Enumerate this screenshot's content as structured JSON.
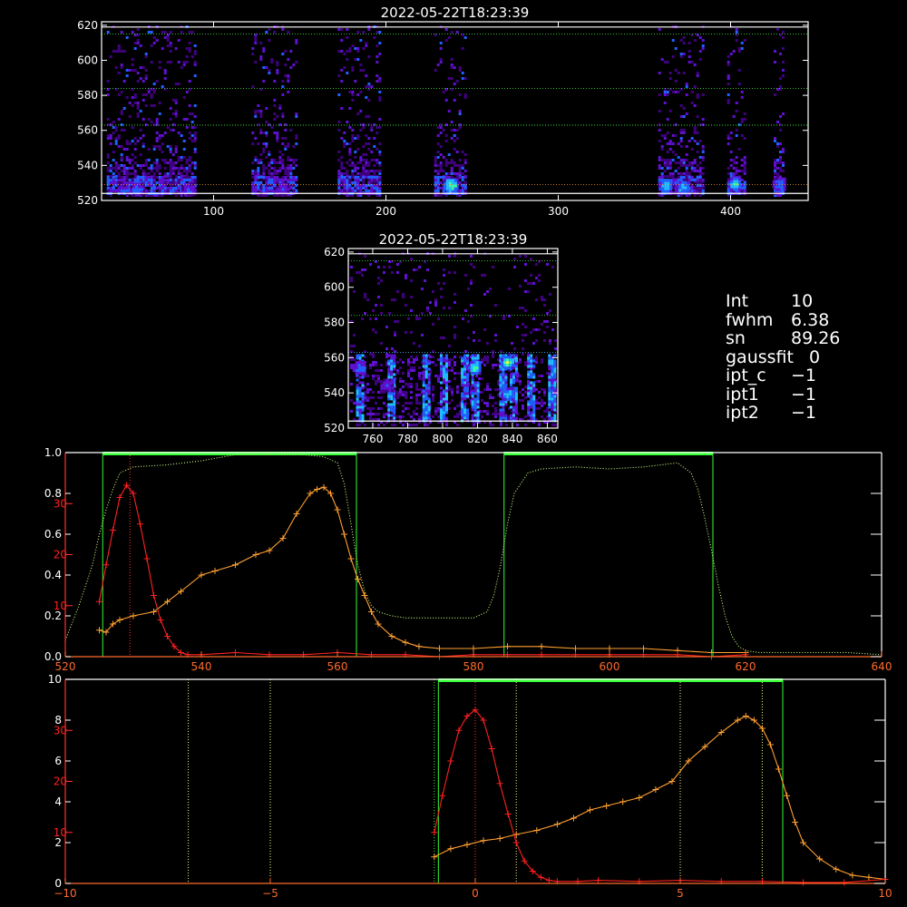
{
  "colors": {
    "background": "#000000",
    "frame": "#ffffff",
    "gaussian_series": "#ff2020",
    "profile_series": "#ffa030",
    "window_line": "#33ff33",
    "transmission_curve": "#c8ff80",
    "guide_line": "#ffff80",
    "right_axis": "#ff2020",
    "bottom_axis": "#ff6a2a"
  },
  "params": [
    {
      "label": "Int",
      "value": "10"
    },
    {
      "label": "fwhm",
      "value": "6.38"
    },
    {
      "label": "sn",
      "value": "89.26"
    },
    {
      "label": "gaussfit",
      "value": "0"
    },
    {
      "label": "ipt_c",
      "value": "−1"
    },
    {
      "label": "ipt1",
      "value": "−1"
    },
    {
      "label": "ipt2",
      "value": "−1"
    }
  ],
  "chart_data": [
    {
      "type": "heatmap",
      "title": "2022-05-22T18:23:39",
      "xlim": [
        35,
        445
      ],
      "ylim": [
        520,
        622
      ],
      "xticks": [
        "100",
        "200",
        "300",
        "400"
      ],
      "yticks": [
        "520",
        "540",
        "560",
        "580",
        "600",
        "620"
      ],
      "columns": [
        [
          38,
          90
        ],
        [
          122,
          148
        ],
        [
          172,
          196
        ],
        [
          228,
          246
        ],
        [
          358,
          384
        ],
        [
          398,
          408
        ],
        [
          425,
          430
        ]
      ],
      "hotspots": [
        {
          "x": 237,
          "y": 529,
          "level": 0.95
        },
        {
          "x": 362,
          "y": 529,
          "level": 0.8
        },
        {
          "x": 372,
          "y": 528,
          "level": 0.75
        },
        {
          "x": 402,
          "y": 530,
          "level": 0.8
        },
        {
          "x": 428,
          "y": 530,
          "level": 0.6
        },
        {
          "x": 55,
          "y": 527,
          "level": 0.55
        },
        {
          "x": 85,
          "y": 527,
          "level": 0.5
        },
        {
          "x": 140,
          "y": 527,
          "level": 0.45
        }
      ],
      "hlines_white": [
        524,
        619
      ],
      "hlines_green": [
        563,
        584,
        615
      ],
      "hlines_orange": [
        529
      ]
    },
    {
      "type": "heatmap",
      "title": "2022-05-22T18:23:39",
      "xlim": [
        746,
        866
      ],
      "ylim": [
        520,
        622
      ],
      "xticks": [
        "760",
        "780",
        "800",
        "820",
        "840",
        "860"
      ],
      "yticks": [
        "520",
        "540",
        "560",
        "580",
        "600",
        "620"
      ],
      "streaks": [
        752,
        770,
        790,
        800,
        812,
        818,
        834,
        840,
        850,
        862
      ],
      "hotspots": [
        {
          "x": 818,
          "y": 555,
          "level": 0.85
        },
        {
          "x": 837,
          "y": 558,
          "level": 0.9
        },
        {
          "x": 837,
          "y": 540,
          "level": 0.7
        },
        {
          "x": 752,
          "y": 555,
          "level": 0.6
        },
        {
          "x": 768,
          "y": 545,
          "level": 0.45
        }
      ],
      "hlines_white": [
        524,
        619
      ],
      "hlines_green": [
        563,
        584,
        615
      ],
      "hlines_blue": [
        563
      ]
    },
    {
      "type": "line",
      "xlim": [
        520,
        640
      ],
      "ylim": [
        0,
        1.0
      ],
      "ylim_right": [
        0,
        40
      ],
      "xticks": [
        "520",
        "540",
        "560",
        "580",
        "600",
        "620",
        "640"
      ],
      "yticks_left": [
        "0.0",
        "0.2",
        "0.4",
        "0.6",
        "0.8",
        "1.0"
      ],
      "yticks_right": [
        "10",
        "20",
        "30"
      ],
      "windows": [
        [
          525.5,
          562.8
        ],
        [
          584.5,
          615.2
        ]
      ],
      "vlines_red": [
        529.5
      ],
      "transmission": {
        "x": [
          520,
          522,
          524,
          525,
          526,
          527,
          528,
          530,
          535,
          540,
          545,
          550,
          555,
          558,
          560,
          561,
          562,
          563,
          564,
          565,
          566,
          568,
          570,
          575,
          580,
          582,
          583,
          584,
          585,
          586,
          588,
          590,
          595,
          600,
          605,
          610,
          612,
          613,
          614,
          615,
          616,
          617,
          618,
          619,
          620,
          622,
          625,
          630,
          635,
          640
        ],
        "y": [
          0.08,
          0.25,
          0.45,
          0.6,
          0.72,
          0.82,
          0.9,
          0.93,
          0.94,
          0.96,
          0.99,
          0.99,
          0.99,
          0.98,
          0.95,
          0.85,
          0.65,
          0.45,
          0.32,
          0.25,
          0.22,
          0.2,
          0.19,
          0.19,
          0.19,
          0.22,
          0.3,
          0.45,
          0.65,
          0.8,
          0.9,
          0.92,
          0.93,
          0.92,
          0.93,
          0.95,
          0.9,
          0.82,
          0.68,
          0.52,
          0.35,
          0.2,
          0.1,
          0.05,
          0.03,
          0.02,
          0.02,
          0.02,
          0.02,
          0.01
        ]
      },
      "gaussian": {
        "x": [
          525,
          526,
          527,
          528,
          529,
          530,
          531,
          532,
          533,
          534,
          535,
          536,
          537,
          538,
          540,
          545,
          550,
          555,
          560,
          565,
          570,
          575,
          580,
          585,
          590,
          595,
          600,
          605,
          610,
          615,
          620
        ],
        "y": [
          0.27,
          0.45,
          0.62,
          0.78,
          0.84,
          0.8,
          0.65,
          0.48,
          0.3,
          0.18,
          0.1,
          0.05,
          0.02,
          0.01,
          0.01,
          0.02,
          0.01,
          0.01,
          0.02,
          0.01,
          0.01,
          0.0,
          0.01,
          0.01,
          0.01,
          0.01,
          0.01,
          0.01,
          0.01,
          0.0,
          0.01
        ]
      },
      "profile": {
        "x": [
          525,
          526,
          527,
          528,
          530,
          533,
          535,
          537,
          540,
          542,
          545,
          548,
          550,
          552,
          554,
          556,
          557,
          558,
          559,
          560,
          561,
          562,
          563,
          564,
          565,
          566,
          568,
          570,
          572,
          575,
          580,
          585,
          590,
          595,
          600,
          605,
          610,
          615,
          620
        ],
        "y": [
          0.13,
          0.12,
          0.16,
          0.18,
          0.2,
          0.22,
          0.27,
          0.32,
          0.4,
          0.42,
          0.45,
          0.5,
          0.52,
          0.58,
          0.7,
          0.8,
          0.82,
          0.83,
          0.8,
          0.72,
          0.6,
          0.48,
          0.38,
          0.3,
          0.22,
          0.16,
          0.1,
          0.07,
          0.05,
          0.04,
          0.04,
          0.05,
          0.05,
          0.04,
          0.04,
          0.04,
          0.03,
          0.02,
          0.02
        ]
      }
    },
    {
      "type": "line",
      "xlim": [
        -10,
        10
      ],
      "ylim": [
        0,
        10
      ],
      "ylim_right": [
        0,
        40
      ],
      "xticks": [
        "−10",
        "−5",
        "0",
        "5",
        "10"
      ],
      "yticks_left": [
        "0",
        "2",
        "4",
        "6",
        "8",
        "10"
      ],
      "yticks_right": [
        "10",
        "20",
        "30"
      ],
      "windows": [
        [
          -0.9,
          7.5
        ]
      ],
      "vlines_yellow": [
        -7,
        -5,
        1,
        5,
        7
      ],
      "vlines_red": [
        0
      ],
      "vlines_green": [
        -1
      ],
      "gaussian": {
        "x": [
          -1.0,
          -0.8,
          -0.6,
          -0.4,
          -0.2,
          0.0,
          0.2,
          0.4,
          0.6,
          0.8,
          1.0,
          1.2,
          1.4,
          1.6,
          1.8,
          2.0,
          2.5,
          3,
          4,
          5,
          6,
          7,
          8,
          9,
          10
        ],
        "y": [
          2.5,
          4.3,
          6.0,
          7.5,
          8.2,
          8.5,
          8.0,
          6.6,
          4.9,
          3.4,
          2.0,
          1.1,
          0.6,
          0.3,
          0.15,
          0.1,
          0.1,
          0.15,
          0.1,
          0.15,
          0.1,
          0.1,
          0.05,
          0.05,
          0.2
        ],
        "right_scale": true
      },
      "profile": {
        "x": [
          -1.0,
          -0.6,
          -0.2,
          0.2,
          0.6,
          1.0,
          1.5,
          2.0,
          2.4,
          2.8,
          3.2,
          3.6,
          4.0,
          4.4,
          4.8,
          5.2,
          5.6,
          6.0,
          6.4,
          6.6,
          6.8,
          7.0,
          7.2,
          7.4,
          7.6,
          7.8,
          8.0,
          8.4,
          8.8,
          9.2,
          9.6,
          10.0
        ],
        "y": [
          1.3,
          1.7,
          1.9,
          2.1,
          2.2,
          2.4,
          2.6,
          2.9,
          3.2,
          3.6,
          3.8,
          4.0,
          4.2,
          4.6,
          5.0,
          6.0,
          6.7,
          7.4,
          8.0,
          8.2,
          8.0,
          7.6,
          6.8,
          5.6,
          4.3,
          3.0,
          2.0,
          1.2,
          0.7,
          0.4,
          0.3,
          0.2
        ]
      }
    }
  ]
}
